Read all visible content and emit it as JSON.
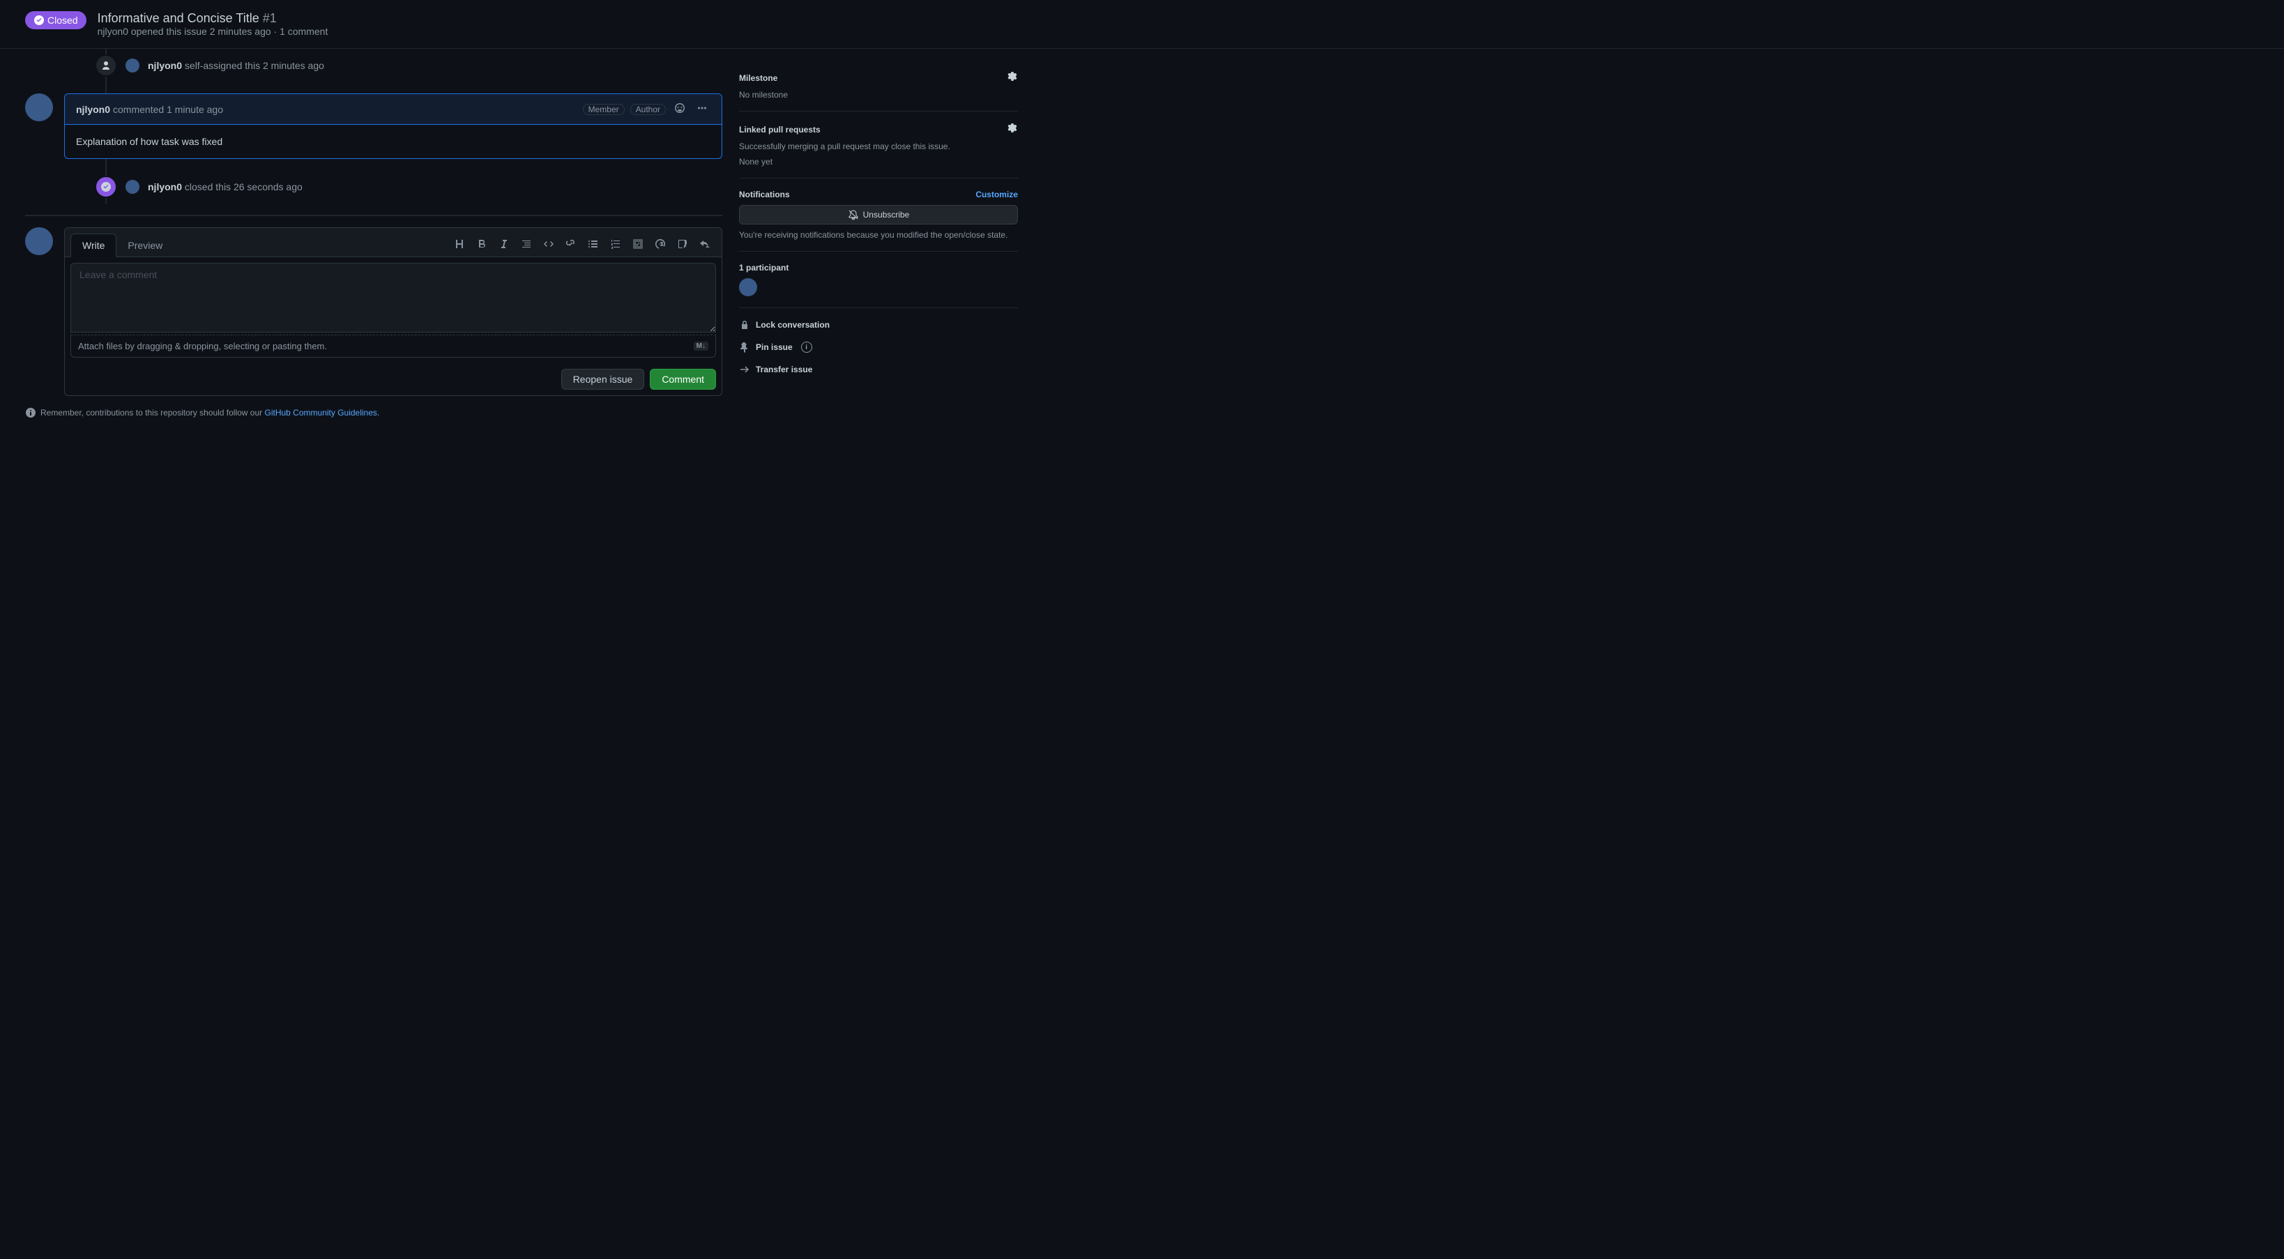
{
  "header": {
    "status": "Closed",
    "title": "Informative and Concise Title",
    "issue_number": "#1",
    "user": "njlyon0",
    "meta_rest": " opened this issue 2 minutes ago · 1 comment"
  },
  "timeline": {
    "assigned": {
      "user": "njlyon0",
      "rest": " self-assigned this 2 minutes ago"
    },
    "comment": {
      "user": "njlyon0",
      "action": " commented ",
      "timestamp": "1 minute ago",
      "role1": "Member",
      "role2": "Author",
      "body": "Explanation of how task was fixed"
    },
    "closed": {
      "user": "njlyon0",
      "rest": " closed this 26 seconds ago"
    }
  },
  "compose": {
    "tab_write": "Write",
    "tab_preview": "Preview",
    "placeholder": "Leave a comment",
    "attach_hint": "Attach files by dragging & dropping, selecting or pasting them.",
    "reopen_btn": "Reopen issue",
    "comment_btn": "Comment",
    "md_badge": "M↓"
  },
  "guidelines": {
    "prefix": "Remember, contributions to this repository should follow our ",
    "link": "GitHub Community Guidelines",
    "suffix": "."
  },
  "sidebar": {
    "milestone": {
      "title": "Milestone",
      "body": "No milestone"
    },
    "linked_prs": {
      "title": "Linked pull requests",
      "desc": "Successfully merging a pull request may close this issue.",
      "none": "None yet"
    },
    "notifications": {
      "title": "Notifications",
      "customize": "Customize",
      "unsubscribe": "Unsubscribe",
      "reason": "You're receiving notifications because you modified the open/close state."
    },
    "participants": {
      "title": "1 participant"
    },
    "actions": {
      "lock": "Lock conversation",
      "pin": "Pin issue",
      "transfer": "Transfer issue"
    }
  }
}
